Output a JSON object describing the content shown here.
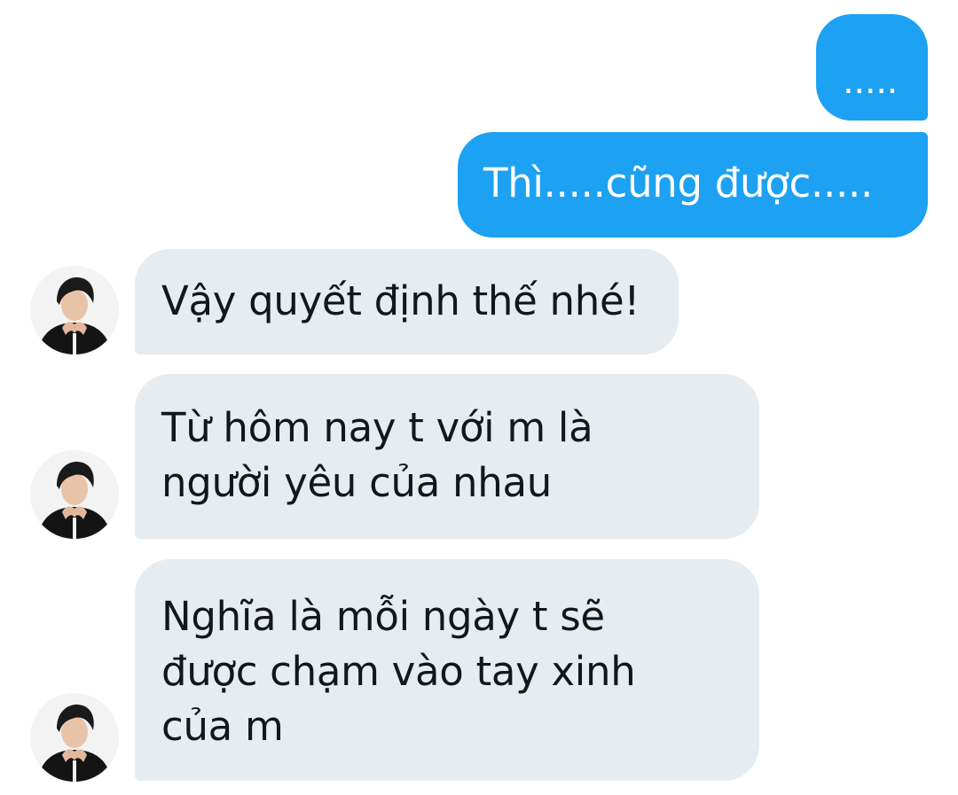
{
  "conversation": {
    "messages": [
      {
        "sender": "me",
        "lines": [
          "....."
        ]
      },
      {
        "sender": "me",
        "lines": [
          "Thì.....cũng được....."
        ]
      },
      {
        "sender": "other",
        "lines": [
          "Vậy quyết định thế nhé!"
        ]
      },
      {
        "sender": "other",
        "lines": [
          "Từ hôm nay t với m là",
          "người yêu của nhau"
        ]
      },
      {
        "sender": "other",
        "lines": [
          "Nghĩa là mỗi ngày t sẽ",
          "được chạm vào tay xinh",
          "của m"
        ]
      }
    ]
  },
  "colors": {
    "outgoing_bubble": "#1da1f2",
    "incoming_bubble": "#e6ecf0",
    "outgoing_text": "#ffffff",
    "incoming_text": "#14171a"
  },
  "icons": {
    "avatar": "contact-avatar-photo"
  }
}
